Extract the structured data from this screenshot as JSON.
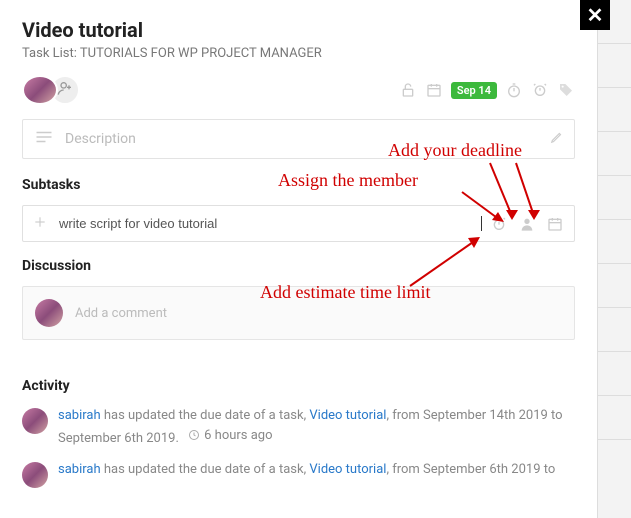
{
  "header": {
    "title": "Video tutorial",
    "tasklist_prefix": "Task List: ",
    "tasklist_name": "TUTORIALS FOR WP PROJECT MANAGER",
    "date_badge": "Sep 14"
  },
  "description": {
    "placeholder": "Description"
  },
  "sections": {
    "subtasks": "Subtasks",
    "discussion": "Discussion",
    "activity": "Activity"
  },
  "subtask": {
    "input_value": "write script for video tutorial"
  },
  "comment": {
    "placeholder": "Add a comment"
  },
  "annotations": {
    "deadline": "Add your deadline",
    "assign": "Assign the member",
    "estimate": "Add estimate time limit"
  },
  "activity": [
    {
      "user": "sabirah",
      "verb": " has updated the due date of a task, ",
      "task": "Video tutorial",
      "suffix": ", from September 14th 2019 to September 6th 2019.",
      "time": "6 hours ago"
    },
    {
      "user": "sabirah",
      "verb": " has updated the due date of a task, ",
      "task": "Video tutorial",
      "suffix": ", from September 6th 2019 to",
      "time": ""
    }
  ]
}
